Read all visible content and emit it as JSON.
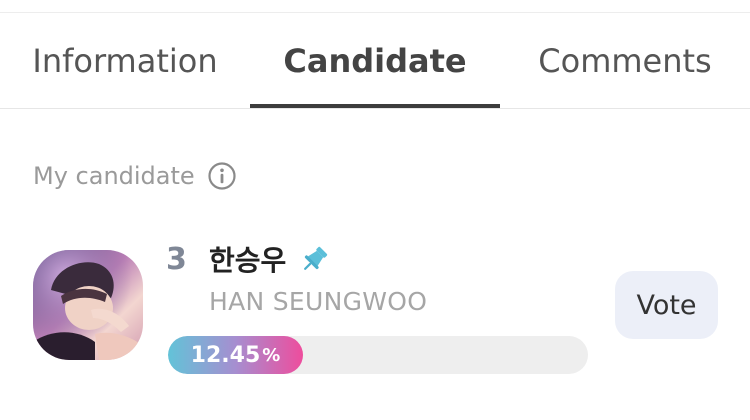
{
  "tabs": [
    {
      "label": "Information",
      "selected": false
    },
    {
      "label": "Candidate",
      "selected": true
    },
    {
      "label": "Comments",
      "selected": false
    }
  ],
  "section": {
    "title": "My candidate",
    "info_icon": "info-circle-icon"
  },
  "candidate": {
    "rank": "3",
    "name_korean": "한승우",
    "name_english": "HAN SEUNGWOO",
    "pinned": true,
    "pin_icon": "pushpin-icon",
    "vote_percent": 12.45,
    "vote_percent_text": "12.45",
    "vote_percent_unit": "%",
    "vote_button_label": "Vote",
    "avatar_icon": "candidate-photo"
  },
  "colors": {
    "active_tab": "#3d3d3d",
    "progress_start": "#62c3d8",
    "progress_end": "#ee4d9d",
    "pin": "#5bbfd9",
    "vote_button_bg": "#eceff8",
    "rank": "#7f8796"
  }
}
